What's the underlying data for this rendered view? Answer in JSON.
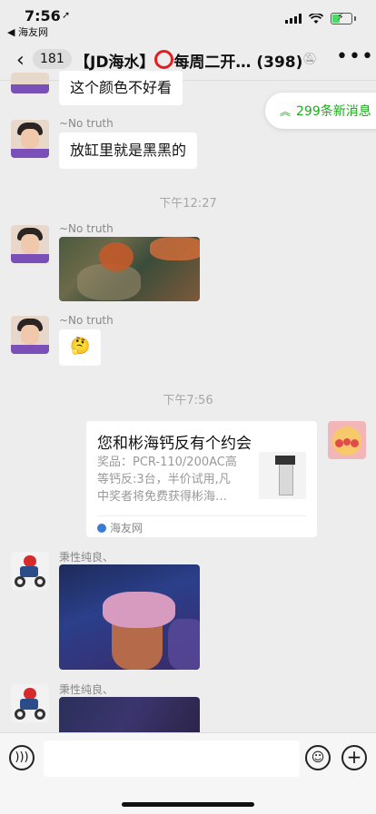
{
  "status": {
    "time": "7:56",
    "location_icon": "location-arrow-icon",
    "back_app": "◀ 海友网"
  },
  "nav": {
    "unread_count": "181",
    "title_prefix": "【JD海水】",
    "title_suffix": "每周二开… (398)",
    "back_icon": "chevron-left-icon",
    "mute_icon": "bell-off-icon",
    "more_icon": "more-dots-icon"
  },
  "new_messages_label": "299条新消息",
  "messages": {
    "m0_text": "这个颜色不好看",
    "m1_sender": "~No truth",
    "m1_text": "放缸里就是黑黑的",
    "ts1": "下午12:27",
    "m2_sender": "~No truth",
    "m3_sender": "~No truth",
    "m3_emoji": "🤔",
    "ts2": "下午7:56",
    "card": {
      "title": "您和彬海钙反有个约会",
      "desc_line1": "奖品：PCR-110/200AC高",
      "desc_line2": "等钙反:3台，半价试用,凡",
      "desc_line3": "中奖者将免费获得彬海…",
      "source": "海友网"
    },
    "m5_sender": "秉性纯良、",
    "m6_sender": "秉性纯良、"
  },
  "input_bar": {
    "voice_icon": "voice-icon",
    "emoji_icon": "emoji-icon",
    "plus_icon": "plus-icon"
  }
}
